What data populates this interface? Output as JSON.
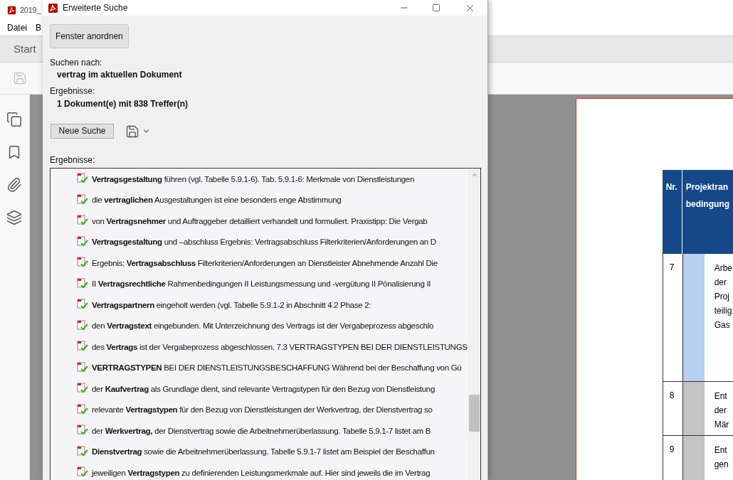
{
  "app": {
    "title": "2019_",
    "menu": [
      "Datei",
      "B"
    ],
    "tab": "Start"
  },
  "document": {
    "table": {
      "columns": [
        [
          "Nr."
        ],
        [
          "Projektran",
          "bedingung"
        ]
      ],
      "rows": [
        {
          "nr": "7",
          "color": "#b8cfee",
          "lines": [
            "Arbe",
            "der",
            "Proj",
            "teilig",
            "Gas"
          ]
        },
        {
          "nr": "8",
          "color": "#c4c4c4",
          "lines": [
            "Ent",
            "der",
            "Mär"
          ]
        },
        {
          "nr": "9",
          "color": "#c4c4c4",
          "lines": [
            "Ent",
            "gen"
          ]
        }
      ]
    }
  },
  "dialog": {
    "title": "Erweiterte Suche",
    "arrange_button": "Fenster anordnen",
    "search_label": "Suchen nach:",
    "search_value": "vertrag im aktuellen Dokument",
    "results_label": "Ergebnisse:",
    "results_value": "1 Dokument(e) mit 838 Treffer(n)",
    "new_search_button": "Neue Suche",
    "list_label": "Ergebnisse:",
    "results": [
      "**Vertragsgestaltung** führen (vgl. Tabelle 5.9.1-6). Tab. 5.9.1-6: Merkmale von Dienstleistungen",
      "die **vertraglichen** Ausgestaltungen ist eine besonders enge Abstimmung",
      "von **Vertragsnehmer** und Auftraggeber detailliert verhandelt und formuliert. Praxistipp: Die Vergab",
      "**Vertragsgestaltung** und –abschluss Ergebnis: Vertragsabschluss Filterkriterien/Anforderungen an D",
      "Ergebnis: **Vertragsabschluss** Filterkriterien/Anforderungen an Dienstleister Abnehmende Anzahl Die",
      "II **Vertragsrechtliche** Rahmenbedingungen II Leistungsmessung und -vergütung II Pönalisierung II",
      "**Vertragspartnern** eingeholt werden (vgl. Tabelle 5.9.1-2 in Abschnitt 4.2 Phase 2:",
      "den **Vertragstext** eingebunden. Mit Unterzeichnung des Vertrags ist der Vergabeprozess abgeschlo",
      "des **Vertrags** ist der Vergabeprozess abgeschlossen. 7.3 VERTRAGSTYPEN BEI DER DIENSTLEISTUNGS",
      "**VERTRAGSTYPEN** BEI DER DIENSTLEISTUNGSBESCHAFFUNG Während bei der Beschaffung von Gü",
      "der **Kaufvertrag** als Grundlage dient, sind relevante Vertragstypen für den Bezug von Dienstleistung",
      "relevante **Vertragstypen** für den Bezug von Dienstleistungen der Werkvertrag, der Dienstvertrag so",
      "der **Werkvertrag,** der Dienstvertrag sowie die Arbeitnehmerüberlassung. Tabelle 5.9.1-7 listet am B",
      "**Dienstvertrag** sowie die Arbeitnehmerüberlassung. Tabelle 5.9.1-7 listet am Beispiel der Beschaffun",
      "jeweiligen **Vertragstypen** zu definierenden Leistungsmerkmale auf. Hier sind jeweils die im Vertrag"
    ]
  }
}
